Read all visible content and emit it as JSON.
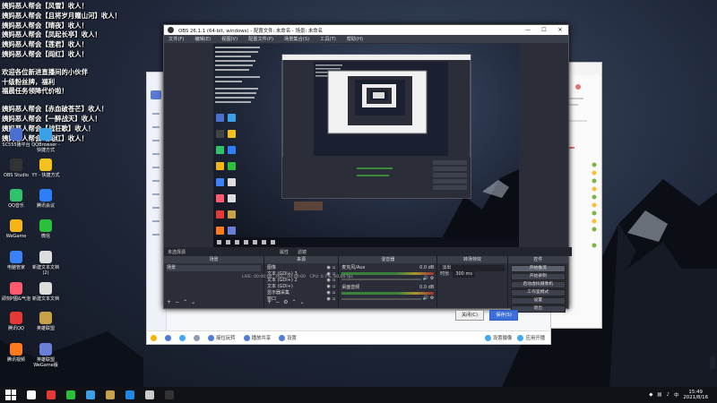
{
  "chat": {
    "lines": [
      "姨妈恶人帮会【风雪】收人！",
      "姨妈恶人帮会【且将岁月赠山河】收人！",
      "姨妈恶人帮会【晴夜】收人！",
      "姨妈恶人帮会【凤起长亭】收人！",
      "姨妈恶人帮会【莲君】收人！",
      "姨妈恶人帮会【阎红】收人！",
      "欢迎各位新进直播间的小伙伴",
      "十级粉丝牌，福利",
      "福晨任务领降代价啦！",
      "姨妈恶人帮会【赤血破苍芒】收人！",
      "姨妈恶人帮会【一醉战天】收人！",
      "姨妈恶人帮会【战狂歌】收人！",
      "姨妈恶人帮会【阎红】收人！"
    ]
  },
  "desktop_icons": [
    {
      "label": "SC555播平台",
      "color": "#4a6fd1"
    },
    {
      "label": "QQBrowser - 快捷方式",
      "color": "#3aa0e8"
    },
    {
      "label": "OBS Studio",
      "color": "#333333"
    },
    {
      "label": "YY - 快捷方式",
      "color": "#f4c21f"
    },
    {
      "label": "QQ音乐",
      "color": "#2fc26a"
    },
    {
      "label": "腾讯会议",
      "color": "#2d7ef7"
    },
    {
      "label": "WeGame",
      "color": "#f4b515"
    },
    {
      "label": "微信",
      "color": "#2bbf3c"
    },
    {
      "label": "电脑管家",
      "color": "#3b82f6"
    },
    {
      "label": "新建文本文档 (2)",
      "color": "#dddddd"
    },
    {
      "label": "即刻P图&气泡",
      "color": "#ff5a6e"
    },
    {
      "label": "新建文本文档",
      "color": "#dddddd"
    },
    {
      "label": "腾讯QQ",
      "color": "#e53935"
    },
    {
      "label": "英雄联盟",
      "color": "#c8a24a"
    },
    {
      "label": "腾讯视频",
      "color": "#ff7a1a"
    },
    {
      "label": "英雄联盟WeGame版",
      "color": "#6b7fd6"
    }
  ],
  "obs": {
    "title": "OBS 26.1.1 (64-bit, windows) - 配置文件: 未命名 - 场景: 未命名",
    "win_controls": [
      "—",
      "☐",
      "✕"
    ],
    "menu": [
      "文件(F)",
      "编辑(E)",
      "视图(V)",
      "配置文件(P)",
      "场景集合(S)",
      "工具(T)",
      "帮助(H)"
    ],
    "scene_bar": {
      "left": "未选择源",
      "props": "属性",
      "filters": "滤镜"
    },
    "docks": {
      "scenes": {
        "header": "场景",
        "items": [
          "场景"
        ]
      },
      "sources": {
        "header": "来源",
        "items": [
          "图像",
          "文本 (GDI+) 3",
          "文本 (GDI+) 2",
          "文本 (GDI+)",
          "显示器采集",
          "窗口"
        ]
      },
      "mixer": {
        "header": "混音器",
        "channels": [
          {
            "name": "麦克风/Aux",
            "db": "0.0 dB"
          },
          {
            "name": "桌面音频",
            "db": "0.0 dB"
          }
        ]
      },
      "transitions": {
        "header": "转场特效",
        "type": "淡出",
        "duration_label": "时长",
        "duration": "300 ms"
      },
      "controls": {
        "header": "控件",
        "buttons": [
          "开始推流",
          "开始录制",
          "启动虚拟摄像机",
          "工作室模式",
          "设置",
          "退出"
        ]
      }
    },
    "status": {
      "live": "LIVE: 00:00:00",
      "rec": "REC: 00:00:00",
      "cpu": "CPU: 0.7%, 60.00 fps"
    }
  },
  "background_window": {
    "taskbar_items": [
      "接位玩转",
      "播放共享",
      "设置"
    ],
    "right_items": [
      "设置摄像",
      "应用开播"
    ],
    "buttons": {
      "close": "关闭(C)",
      "save": "保存(S)"
    }
  },
  "taskbar": {
    "clock_time": "15:49",
    "clock_date": "2021/8/16",
    "ime": "中",
    "colors": [
      "#ffffff",
      "#e53935",
      "#2bbf3c",
      "#3aa0e8",
      "#c8a24a",
      "#1e88e5",
      "#cccccc",
      "#333333"
    ]
  }
}
